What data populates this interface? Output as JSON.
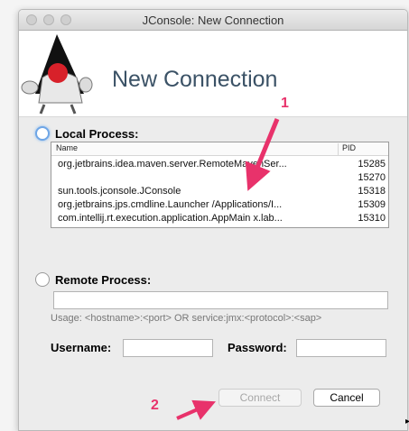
{
  "window": {
    "title": "JConsole: New Connection"
  },
  "banner": {
    "heading": "New Connection"
  },
  "local": {
    "label": "Local Process:",
    "columns": {
      "name": "Name",
      "pid": "PID"
    },
    "rows": [
      {
        "name": "org.jetbrains.idea.maven.server.RemoteMavenSer...",
        "pid": "15285"
      },
      {
        "name": "",
        "pid": "15270"
      },
      {
        "name": "sun.tools.jconsole.JConsole",
        "pid": "15318"
      },
      {
        "name": "org.jetbrains.jps.cmdline.Launcher /Applications/I...",
        "pid": "15309"
      },
      {
        "name": "com.intellij.rt.execution.application.AppMain x.lab...",
        "pid": "15310"
      }
    ]
  },
  "remote": {
    "label": "Remote Process:",
    "address_value": "",
    "usage_prefix": "Usage:",
    "usage_text": "<hostname>:<port> OR service:jmx:<protocol>:<sap>",
    "username_label": "Username:",
    "username_value": "",
    "password_label": "Password:",
    "password_value": ""
  },
  "buttons": {
    "connect": "Connect",
    "cancel": "Cancel"
  },
  "annotations": {
    "one": "1",
    "two": "2",
    "color": "#e8326b"
  }
}
